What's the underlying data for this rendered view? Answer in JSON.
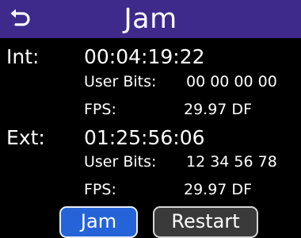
{
  "header": {
    "title": "Jam",
    "back_icon": "return-arrow-icon",
    "background": "#3d2a8a"
  },
  "internal": {
    "label": "Int:",
    "timecode": "00:04:19:22",
    "user_bits_label": "User Bits:",
    "user_bits_value": "00 00 00 00",
    "fps_label": "FPS:",
    "fps_value": "29.97 DF"
  },
  "external": {
    "label": "Ext:",
    "timecode": "01:25:56:06",
    "user_bits_label": "User Bits:",
    "user_bits_value": "12 34 56 78",
    "fps_label": "FPS:",
    "fps_value": "29.97 DF"
  },
  "buttons": {
    "jam_label": "Jam",
    "restart_label": "Restart",
    "jam_color": "#2563d9",
    "restart_color": "#3a3a3a"
  }
}
